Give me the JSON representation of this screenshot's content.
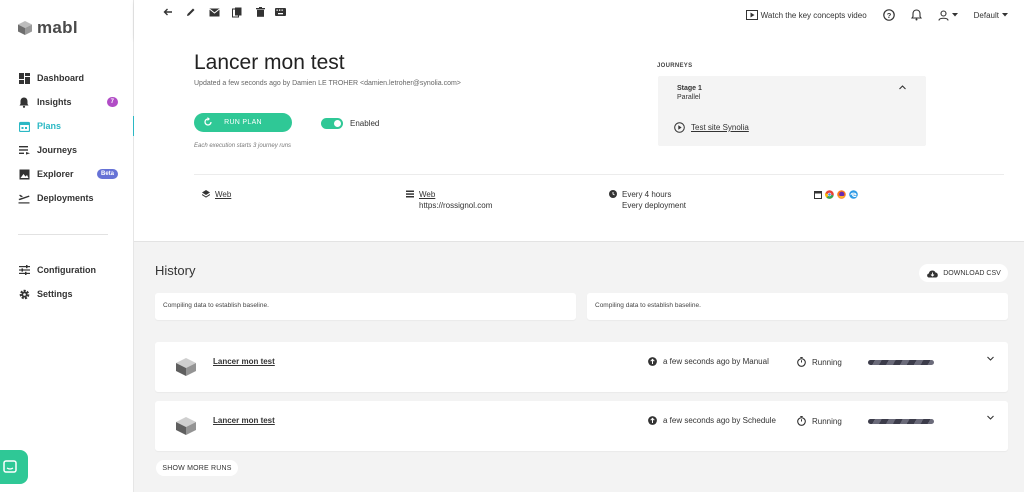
{
  "app": {
    "name": "mabl"
  },
  "sidebar": {
    "items": [
      {
        "label": "Dashboard",
        "icon": "dashboard-icon"
      },
      {
        "label": "Insights",
        "icon": "bell-icon",
        "badge": "7"
      },
      {
        "label": "Plans",
        "icon": "calendar-icon",
        "active": true
      },
      {
        "label": "Journeys",
        "icon": "list-icon"
      },
      {
        "label": "Explorer",
        "icon": "image-icon",
        "badge": "Beta"
      },
      {
        "label": "Deployments",
        "icon": "plane-icon"
      }
    ],
    "bottom_items": [
      {
        "label": "Configuration",
        "icon": "sliders-icon"
      },
      {
        "label": "Settings",
        "icon": "gear-icon"
      }
    ]
  },
  "topbar": {
    "watch_label": "Watch the key concepts video",
    "workspace": "Default"
  },
  "plan": {
    "title": "Lancer mon test",
    "updated": "Updated a few seconds ago by Damien LE TROHER <damien.letroher@synolia.com>",
    "run_label": "RUN PLAN",
    "enabled_label": "Enabled",
    "exec_note": "Each execution starts 3 journey runs",
    "journeys_header": "JOURNEYS",
    "stage_title": "Stage 1",
    "stage_mode": "Parallel",
    "journey_name": "Test site Synolia",
    "env": "Web",
    "app_name": "Web",
    "app_url": "https://rossignol.com",
    "schedule_1": "Every 4 hours",
    "schedule_2": "Every deployment"
  },
  "history": {
    "title": "History",
    "download_label": "DOWNLOAD CSV",
    "baseline_1": "Compiling data to establish baseline.",
    "baseline_2": "Compiling data to establish baseline.",
    "runs": [
      {
        "name": "Lancer mon test",
        "when": "a few seconds ago by Manual",
        "status": "Running"
      },
      {
        "name": "Lancer mon test",
        "when": "a few seconds ago by Schedule",
        "status": "Running"
      }
    ],
    "more_label": "SHOW MORE RUNS"
  },
  "colors": {
    "accent": "#2bb8c4",
    "green": "#2fc896",
    "insights_badge": "#b14cc6",
    "beta_badge": "#6672d6"
  }
}
